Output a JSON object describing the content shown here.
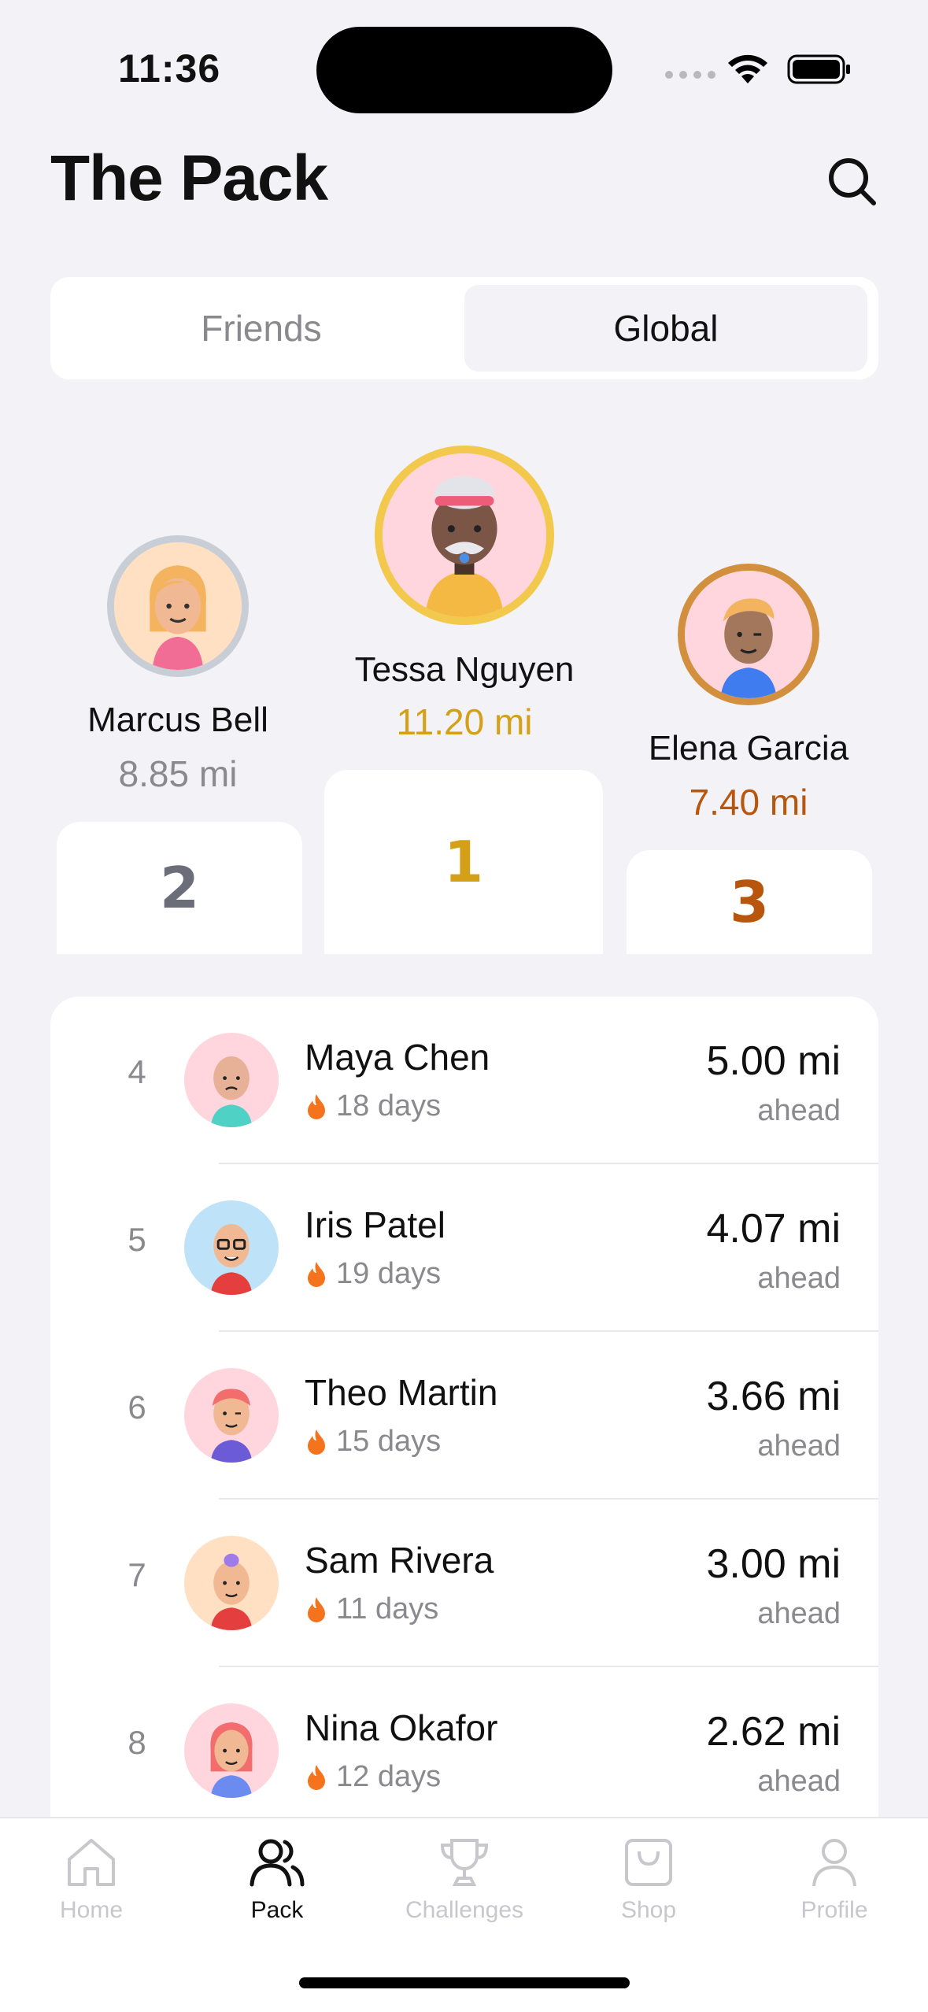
{
  "status_bar": {
    "time": "11:36"
  },
  "header": {
    "title": "The Pack"
  },
  "segments": {
    "friends": "Friends",
    "global": "Global",
    "selected": "Global"
  },
  "podium": {
    "first": {
      "rank": "1",
      "name": "Tessa Nguyen",
      "distance": "11.20 mi",
      "color": "#D4A017",
      "ring": "#F2C94C"
    },
    "second": {
      "rank": "2",
      "name": "Marcus Bell",
      "distance": "8.85 mi",
      "color": "#6B6E78",
      "ring": "#C9CED6"
    },
    "third": {
      "rank": "3",
      "name": "Elena Garcia",
      "distance": "7.40 mi",
      "color": "#B8560E",
      "ring": "#D2903F"
    }
  },
  "list": [
    {
      "rank": "4",
      "name": "Maya Chen",
      "streak": "18 days",
      "distance": "5.00 mi",
      "sub": "ahead"
    },
    {
      "rank": "5",
      "name": "Iris Patel",
      "streak": "19 days",
      "distance": "4.07 mi",
      "sub": "ahead"
    },
    {
      "rank": "6",
      "name": "Theo Martin",
      "streak": "15 days",
      "distance": "3.66 mi",
      "sub": "ahead"
    },
    {
      "rank": "7",
      "name": "Sam Rivera",
      "streak": "11 days",
      "distance": "3.00 mi",
      "sub": "ahead"
    },
    {
      "rank": "8",
      "name": "Nina Okafor",
      "streak": "12 days",
      "distance": "2.62 mi",
      "sub": "ahead"
    }
  ],
  "tabs": [
    {
      "label": "Home",
      "icon": "home-icon"
    },
    {
      "label": "Pack",
      "icon": "pack-icon",
      "active": true
    },
    {
      "label": "Challenges",
      "icon": "trophy-icon"
    },
    {
      "label": "Shop",
      "icon": "shop-icon"
    },
    {
      "label": "Profile",
      "icon": "profile-icon"
    }
  ],
  "colors": {
    "accent_flame": "#F5731C",
    "background": "#F2F2F7"
  }
}
